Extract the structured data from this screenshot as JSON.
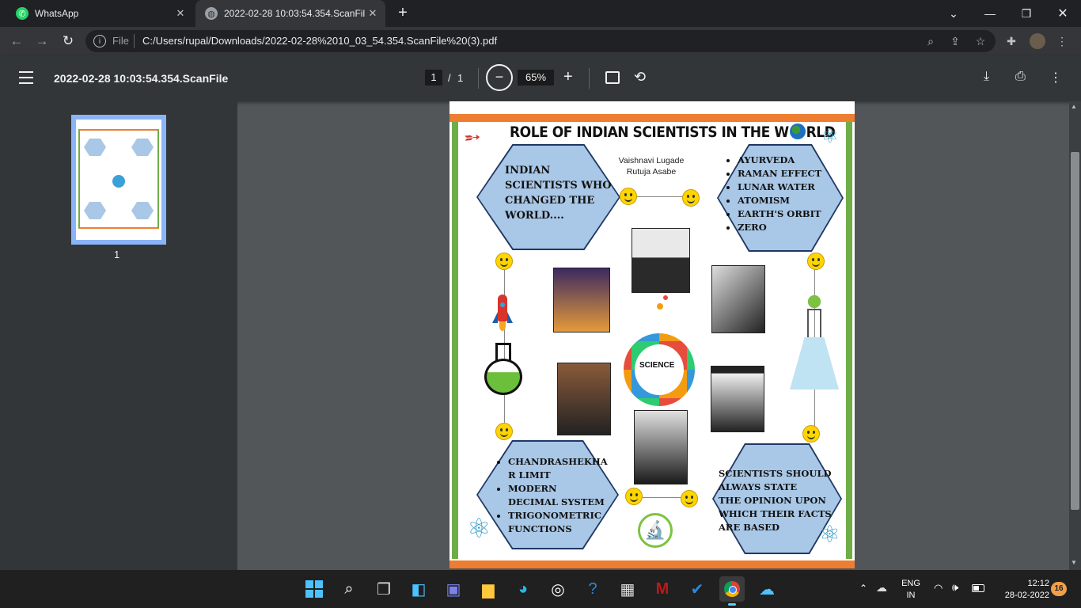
{
  "tabs": [
    {
      "title": "WhatsApp"
    },
    {
      "title": "2022-02-28 10:03:54.354.ScanFile"
    }
  ],
  "address": {
    "scheme": "File",
    "url": "C:/Users/rupal/Downloads/2022-02-28%2010_03_54.354.ScanFile%20(3).pdf"
  },
  "pdf": {
    "title": "2022-02-28 10:03:54.354.ScanFile",
    "current_page": "1",
    "separator": "/",
    "total_pages": "1",
    "zoom": "65%",
    "thumbnail_label": "1"
  },
  "poster": {
    "title_left": "ROLE OF INDIAN SCIENTISTS IN THE W",
    "title_right": "RLD",
    "authors": [
      "Vaishnavi Lugade",
      "Rutuja Asabe"
    ],
    "hex_top_left": [
      "INDIAN",
      "SCIENTISTS WHO",
      "CHANGED THE",
      "WORLD...."
    ],
    "hex_top_right": [
      "AYURVEDA",
      "RAMAN EFFECT",
      "LUNAR WATER",
      "ATOMISM",
      "EARTH'S ORBIT",
      "ZERO"
    ],
    "hex_bottom_left": [
      "CHANDRASHEKHA R LIMIT",
      "MODERN DECIMAL SYSTEM",
      "TRIGONOMETRIC FUNCTIONS"
    ],
    "hex_bottom_right": [
      "SCIENTISTS SHOULD",
      "ALWAYS STATE",
      "THE OPINION UPON",
      "WHICH THEIR FACTS",
      "ARE BASED"
    ],
    "center_label": "SCIENCE"
  },
  "taskbar": {
    "lang_top": "ENG",
    "lang_bottom": "IN",
    "time": "12:12",
    "date": "28-02-2022",
    "notifications": "16"
  }
}
